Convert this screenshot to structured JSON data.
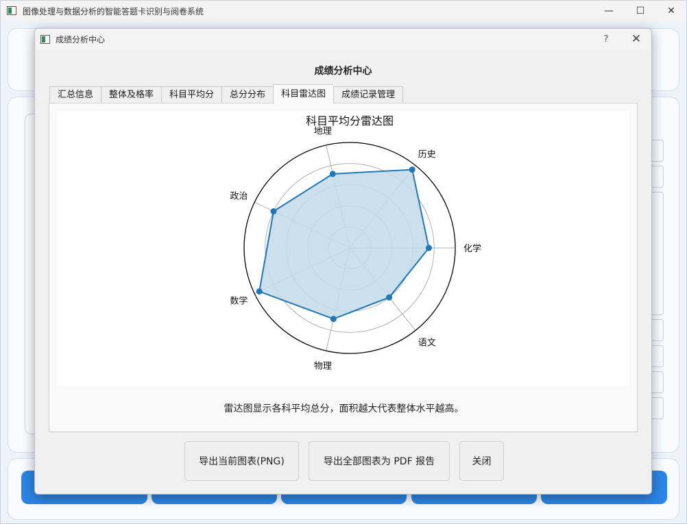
{
  "main_window": {
    "title": "图像处理与数据分析的智能答题卡识别与阅卷系统",
    "controls": [
      "—",
      "☐",
      "✕"
    ]
  },
  "dialog": {
    "title": "成绩分析中心",
    "help": "?",
    "close": "✕",
    "heading": "成绩分析中心",
    "tabs": [
      {
        "label": "汇总信息",
        "active": false
      },
      {
        "label": "整体及格率",
        "active": false
      },
      {
        "label": "科目平均分",
        "active": false
      },
      {
        "label": "总分分布",
        "active": false
      },
      {
        "label": "科目雷达图",
        "active": true
      },
      {
        "label": "成绩记录管理",
        "active": false
      }
    ],
    "caption": "雷达图显示各科平均总分，面积越大代表整体水平越高。",
    "buttons": {
      "export_png": "导出当前图表(PNG)",
      "export_pdf": "导出全部图表为 PDF 报告",
      "close": "关闭"
    }
  },
  "chart_data": {
    "type": "radar",
    "title": "科目平均分雷达图",
    "categories": [
      "化学",
      "历史",
      "地理",
      "政治",
      "数学",
      "物理",
      "语文"
    ],
    "values": [
      0.75,
      0.95,
      0.72,
      0.8,
      0.95,
      0.69,
      0.6
    ],
    "rlim": [
      0,
      1
    ],
    "grid": true,
    "colors": {
      "line": "#1f77b4",
      "fill": "#c5dbeb",
      "grid": "#b0b0b0"
    }
  }
}
